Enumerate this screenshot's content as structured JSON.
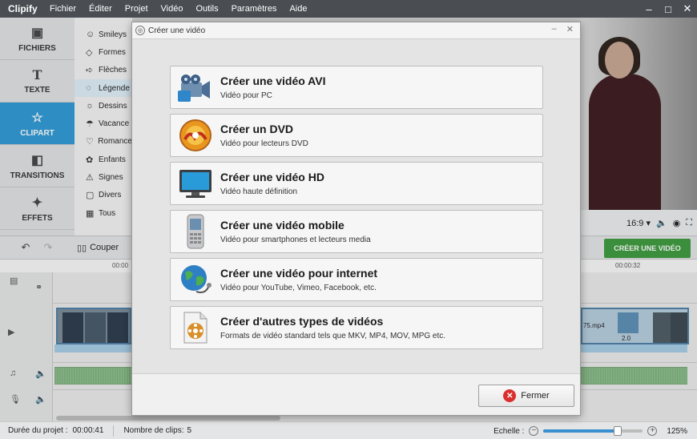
{
  "app": {
    "name": "Clipify"
  },
  "menu": [
    "Fichier",
    "Éditer",
    "Projet",
    "Vidéo",
    "Outils",
    "Paramètres",
    "Aide"
  ],
  "window_controls": [
    "–",
    "□",
    "✕"
  ],
  "tools": [
    {
      "label": "FICHIERS",
      "icon": "image-icon"
    },
    {
      "label": "TEXTE",
      "icon": "text-icon"
    },
    {
      "label": "CLIPART",
      "icon": "star-icon",
      "active": true
    },
    {
      "label": "TRANSITIONS",
      "icon": "transitions-icon"
    },
    {
      "label": "EFFETS",
      "icon": "magic-wand-icon"
    }
  ],
  "clipart_categories": [
    "Smileys",
    "Formes",
    "Flèches",
    "Légende",
    "Dessins",
    "Vacance",
    "Romance",
    "Enfants",
    "Signes",
    "Divers",
    "Tous"
  ],
  "preview": {
    "aspect": "16:9"
  },
  "toolbar": {
    "cut_label": "Couper",
    "create_label": "CRÉER UNE VIDÉO"
  },
  "ruler": {
    "t1": "00:00",
    "t2": "00:00:32"
  },
  "clips": {
    "right_name": "75.mp4",
    "right_value": "2.0"
  },
  "status": {
    "duration_label": "Durée du projet :",
    "duration_value": "00:00:41",
    "clips_label": "Nombre de clips:",
    "clips_value": "5",
    "scale_label": "Echelle :",
    "scale_value": "125%",
    "scale_level": 0.75
  },
  "dialog": {
    "title": "Créer une vidéo",
    "options": [
      {
        "title": "Créer une vidéo AVI",
        "desc": "Vidéo pour PC",
        "icon": "film-reel-icon"
      },
      {
        "title": "Créer un DVD",
        "desc": "Vidéo pour lecteurs DVD",
        "icon": "dvd-icon"
      },
      {
        "title": "Créer une vidéo HD",
        "desc": "Vidéo haute définition",
        "icon": "tv-monitor-icon"
      },
      {
        "title": "Créer une vidéo mobile",
        "desc": "Vidéo pour smartphones et lecteurs media",
        "icon": "mobile-phone-icon"
      },
      {
        "title": "Créer une vidéo pour internet",
        "desc": "Vidéo pour YouTube, Vimeo, Facebook, etc.",
        "icon": "globe-icon"
      },
      {
        "title": "Créer d'autres types de vidéos",
        "desc": "Formats de vidéo standard tels que MKV, MP4, MOV, MPG etc.",
        "icon": "video-file-icon"
      }
    ],
    "close_label": "Fermer"
  }
}
